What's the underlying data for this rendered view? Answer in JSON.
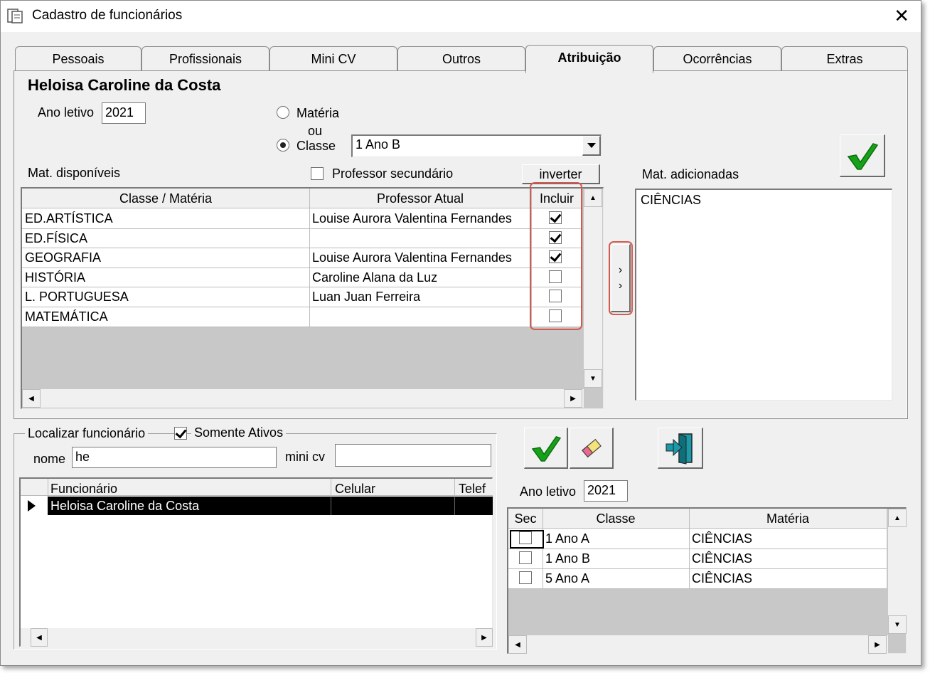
{
  "window": {
    "title": "Cadastro de funcionários"
  },
  "tabs": [
    {
      "label": "Pessoais"
    },
    {
      "label": "Profissionais"
    },
    {
      "label": "Mini CV"
    },
    {
      "label": "Outros"
    },
    {
      "label": "Atribuição"
    },
    {
      "label": "Ocorrências"
    },
    {
      "label": "Extras"
    }
  ],
  "active_tab": "Atribuição",
  "employee_name": "Heloisa Caroline da Costa",
  "top_form": {
    "ano_label": "Ano letivo",
    "ano_value": "2021",
    "radio_materia": "Matéria",
    "ou_label": "ou",
    "radio_classe": "Classe",
    "classe_selected": "1 Ano B",
    "mat_disponiveis_label": "Mat. disponíveis",
    "professor_secundario_label": "Professor secundário",
    "inverter_label": "inverter",
    "mat_adicionadas_label": "Mat. adicionadas"
  },
  "materias_grid": {
    "headers": [
      "Classe / Matéria",
      "Professor Atual",
      "Incluir"
    ],
    "rows": [
      {
        "materia": "ED.ARTÍSTICA",
        "professor": "Louise Aurora Valentina Fernandes",
        "incluir": true
      },
      {
        "materia": "ED.FÍSICA",
        "professor": "",
        "incluir": true
      },
      {
        "materia": "GEOGRAFIA",
        "professor": "Louise Aurora Valentina Fernandes",
        "incluir": true
      },
      {
        "materia": "HISTÓRIA",
        "professor": "Caroline Alana da Luz",
        "incluir": false
      },
      {
        "materia": "L. PORTUGUESA",
        "professor": "Luan Juan Ferreira",
        "incluir": false
      },
      {
        "materia": "MATEMÁTICA",
        "professor": "",
        "incluir": false
      }
    ]
  },
  "mat_adicionadas": [
    "CIÊNCIAS"
  ],
  "localizar": {
    "group_label": "Localizar funcionário",
    "somente_ativos_label": "Somente Ativos",
    "somente_ativos_checked": true,
    "nome_label": "nome",
    "nome_value": "he",
    "minicv_label": "mini cv",
    "minicv_value": ""
  },
  "funcionarios_grid": {
    "headers": [
      "Funcionário",
      "Celular",
      "Telef"
    ],
    "rows": [
      {
        "funcionario": "Heloisa Caroline da Costa",
        "celular": "",
        "telefone": ""
      }
    ]
  },
  "bottom_right": {
    "ano_label": "Ano letivo",
    "ano_value": "2021"
  },
  "atribuicoes_grid": {
    "headers": [
      "Sec",
      "Classe",
      "Matéria"
    ],
    "rows": [
      {
        "sec": false,
        "classe": "1 Ano A",
        "materia": "CIÊNCIAS"
      },
      {
        "sec": false,
        "classe": "1 Ano B",
        "materia": "CIÊNCIAS"
      },
      {
        "sec": false,
        "classe": "5 Ano A",
        "materia": "CIÊNCIAS"
      }
    ]
  },
  "colors": {
    "accent_check": "#1aa01a",
    "highlight_outline": "#d45a4f",
    "selected_row_bg": "#000000"
  }
}
